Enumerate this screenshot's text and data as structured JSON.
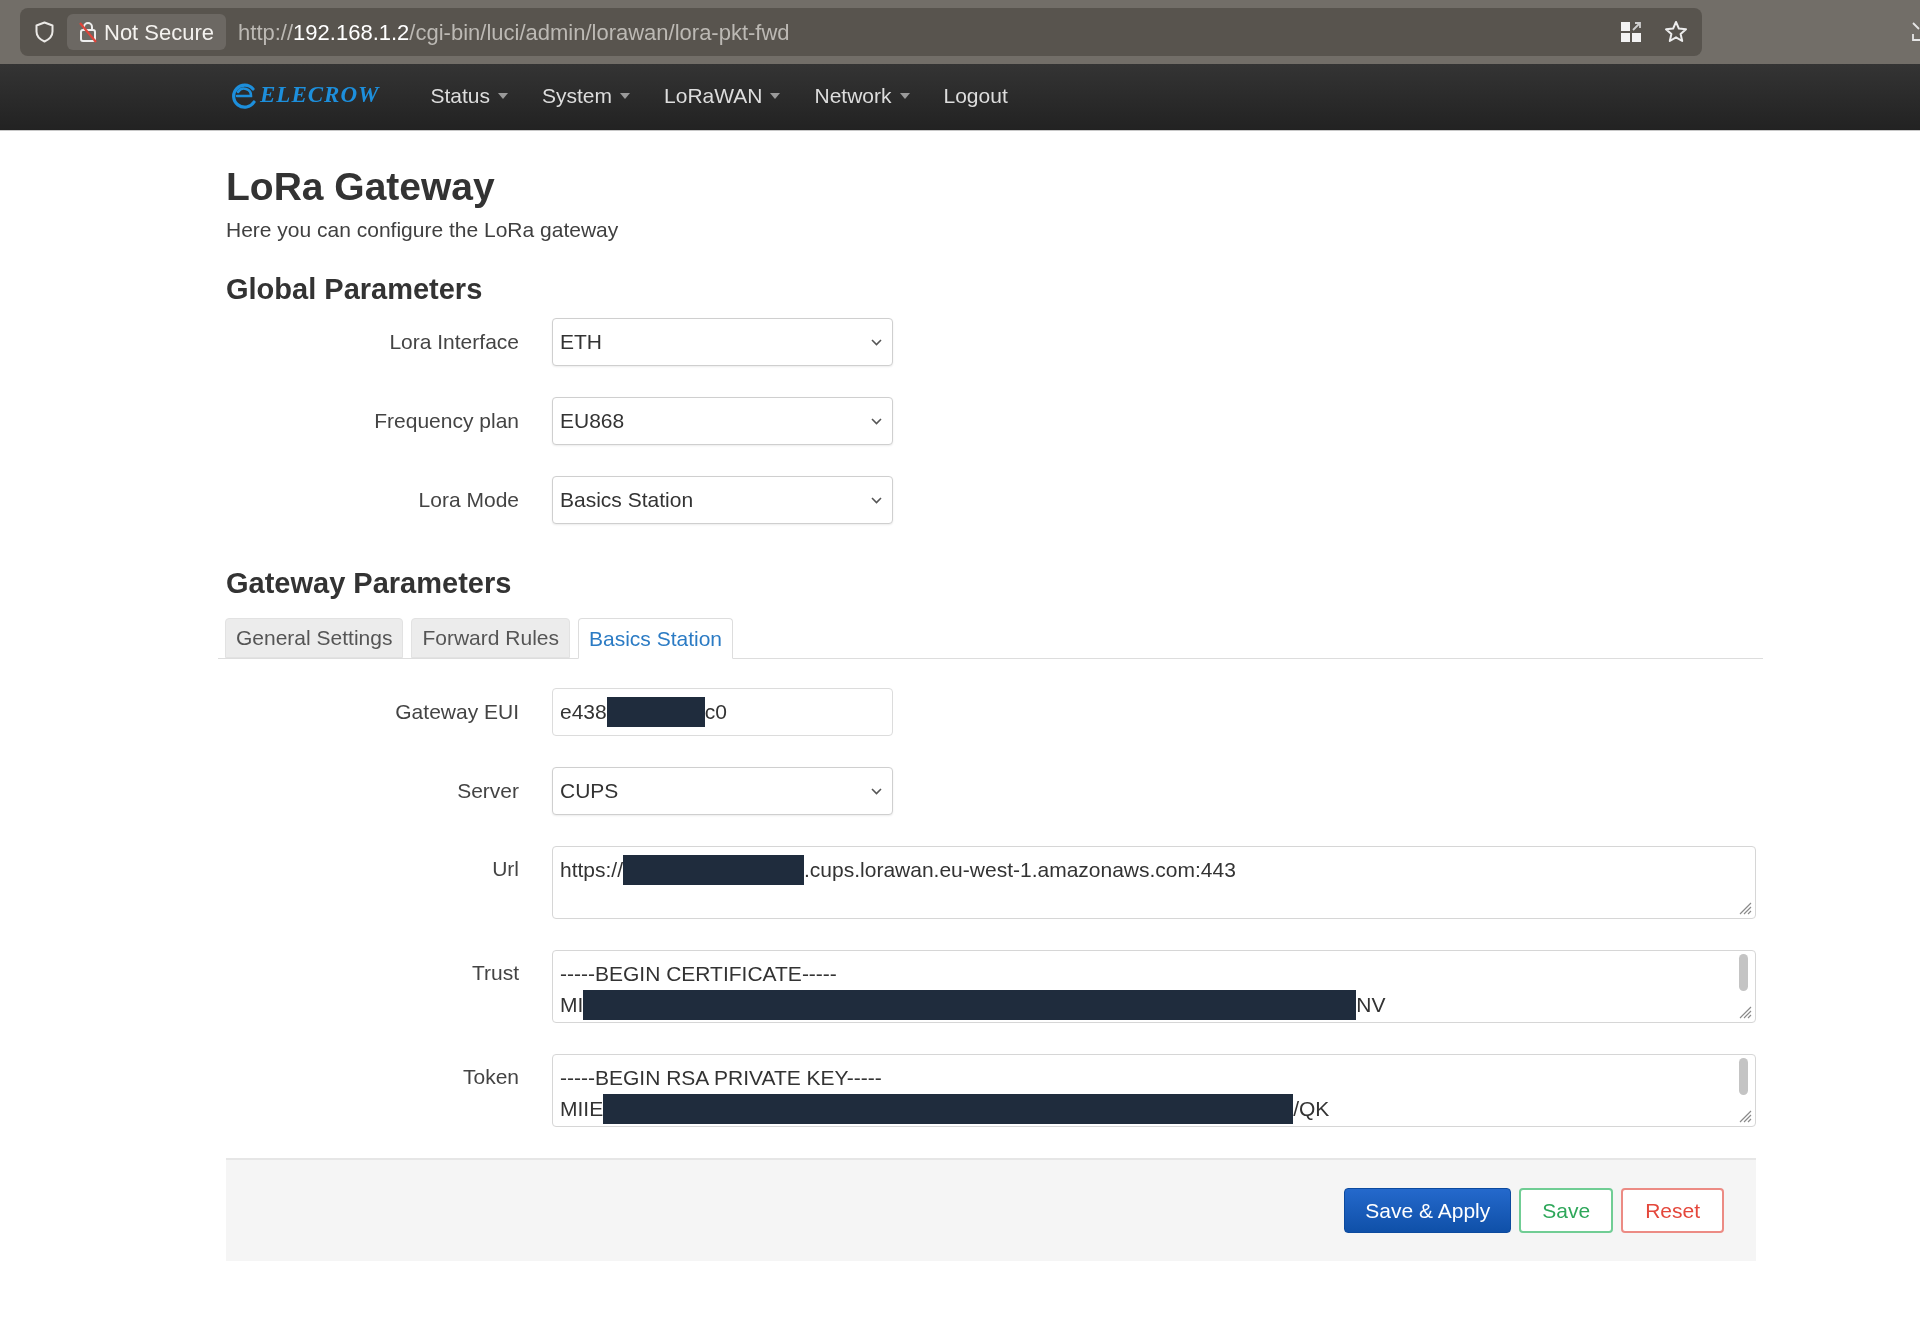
{
  "browser": {
    "security_label": "Not Secure",
    "url": {
      "scheme": "http://",
      "host": "192.168.1.2",
      "path": "/cgi-bin/luci/admin/lorawan/lora-pkt-fwd"
    }
  },
  "navbar": {
    "logo": "ELECROW",
    "menu": [
      {
        "label": "Status",
        "dropdown": true
      },
      {
        "label": "System",
        "dropdown": true
      },
      {
        "label": "LoRaWAN",
        "dropdown": true
      },
      {
        "label": "Network",
        "dropdown": true
      },
      {
        "label": "Logout",
        "dropdown": false
      }
    ]
  },
  "page": {
    "title": "LoRa Gateway",
    "description": "Here you can configure the LoRa gateway"
  },
  "global_parameters": {
    "heading": "Global Parameters",
    "fields": [
      {
        "label": "Lora Interface",
        "kind": "select",
        "value": "ETH"
      },
      {
        "label": "Frequency plan",
        "kind": "select",
        "value": "EU868"
      },
      {
        "label": "Lora Mode",
        "kind": "select",
        "value": "Basics Station"
      }
    ]
  },
  "gateway_parameters": {
    "heading": "Gateway Parameters",
    "tabs": [
      {
        "label": "General Settings",
        "selected": false
      },
      {
        "label": "Forward Rules",
        "selected": false
      },
      {
        "label": "Basics Station",
        "selected": true
      }
    ],
    "fields": [
      {
        "label": "Gateway EUI",
        "kind": "text",
        "lines": [
          [
            {
              "kind": "text",
              "text": "e438"
            },
            {
              "kind": "redacted"
            },
            {
              "kind": "text",
              "text": "c0"
            }
          ]
        ]
      },
      {
        "label": "Server",
        "kind": "select",
        "value": "CUPS"
      },
      {
        "label": "Url",
        "kind": "textarea",
        "lines": [
          [
            {
              "kind": "text",
              "text": "https://"
            },
            {
              "kind": "redacted"
            },
            {
              "kind": "text",
              "text": ".cups.lorawan.eu-west-1.amazonaws.com:443"
            }
          ]
        ]
      },
      {
        "label": "Trust",
        "kind": "textarea",
        "lines": [
          [
            {
              "kind": "text",
              "text": "-----BEGIN CERTIFICATE-----"
            }
          ],
          [
            {
              "kind": "text",
              "text": "MI"
            },
            {
              "kind": "redacted"
            },
            {
              "kind": "text",
              "text": "NV"
            }
          ]
        ]
      },
      {
        "label": "Token",
        "kind": "textarea",
        "lines": [
          [
            {
              "kind": "text",
              "text": "-----BEGIN RSA PRIVATE KEY-----"
            }
          ],
          [
            {
              "kind": "text",
              "text": "MIIE"
            },
            {
              "kind": "redacted"
            },
            {
              "kind": "text",
              "text": "/QK"
            }
          ]
        ]
      }
    ]
  },
  "actions": [
    {
      "label": "Save & Apply",
      "kind": "primary"
    },
    {
      "label": "Save",
      "kind": "save"
    },
    {
      "label": "Reset",
      "kind": "reset"
    }
  ]
}
